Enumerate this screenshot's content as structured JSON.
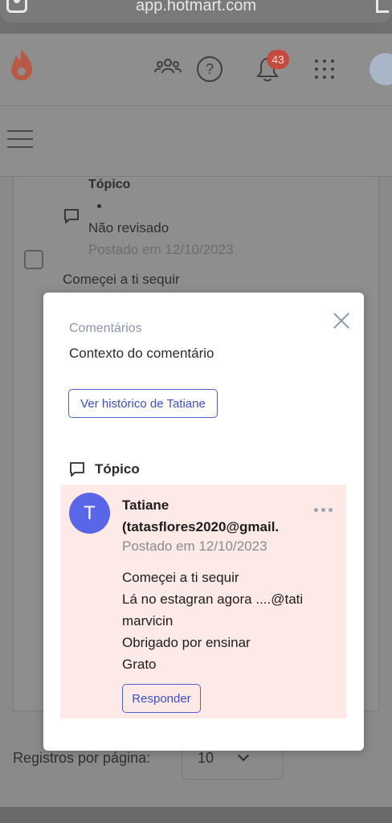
{
  "browser": {
    "url": "app.hotmart.com"
  },
  "header": {
    "notification_count": "43"
  },
  "background": {
    "topic_label": "Tópico",
    "status": "Não revisado",
    "posted": "Postado em 12/10/2023",
    "comment_preview": "Começei a ti sequir",
    "pager_label": "Registros por página:",
    "pager_value": "10"
  },
  "modal": {
    "title": "Comentários",
    "subtitle": "Contexto do comentário",
    "history_button": "Ver histórico de Tatiane",
    "topic_label": "Tópico",
    "comment": {
      "avatar_initial": "T",
      "author_line1": "Tatiane",
      "author_line2": "(tatasflores2020@gmail.",
      "date": "Postado em 12/10/2023",
      "lines": [
        "Começei a ti sequir",
        "Lá no estagran agora ....@tati",
        "marvicin",
        "Obrigado por ensinar",
        "Grato"
      ],
      "reply_button": "Responder"
    }
  },
  "colors": {
    "accent": "#4d5ed9",
    "avatar": "#5a66e8",
    "highlight": "#fde9e6",
    "badge": "#c54a3e"
  }
}
